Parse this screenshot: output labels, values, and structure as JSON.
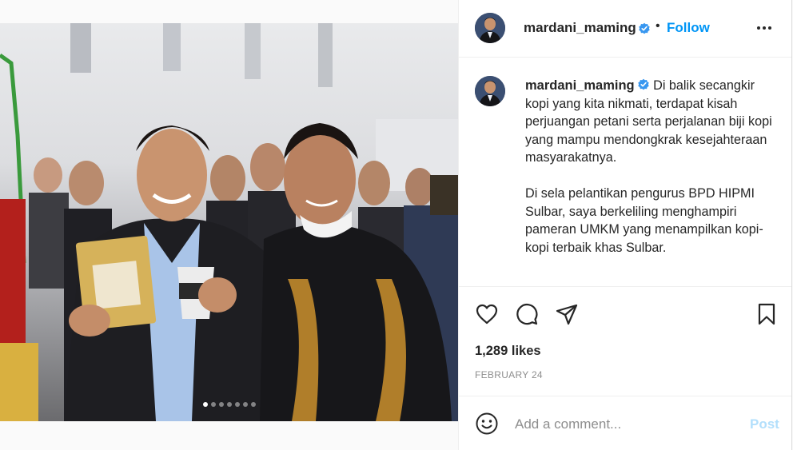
{
  "post": {
    "username": "mardani_maming",
    "follow_label": "Follow",
    "bullet": "•",
    "caption": {
      "paragraph_1": "Di balik secangkir kopi yang kita nikmati, terdapat kisah perjuangan petani serta perjalanan biji kopi yang mampu mendongkrak kesejahteraan masyarakatnya.",
      "paragraph_2": "Di sela pelantikan pengurus BPD HIPMI Sulbar, saya berkeliling menghampiri pameran UMKM yang menampilkan kopi-kopi terbaik khas Sulbar."
    },
    "likes": "1,289 likes",
    "date": "FEBRUARY 24",
    "carousel": {
      "total": 7,
      "active": 0
    }
  },
  "comment": {
    "placeholder": "Add a comment...",
    "post_label": "Post"
  },
  "icons": {
    "verified": "verified-badge-icon",
    "more": "more-options-icon",
    "like": "heart-icon",
    "comment": "comment-bubble-icon",
    "share": "paper-plane-icon",
    "save": "bookmark-icon",
    "emoji": "emoji-smile-icon"
  },
  "colors": {
    "accent": "#0095f6",
    "post_disabled": "#b2dffc",
    "text": "#262626",
    "muted": "#8e8e8e",
    "verified": "#3897f0"
  }
}
